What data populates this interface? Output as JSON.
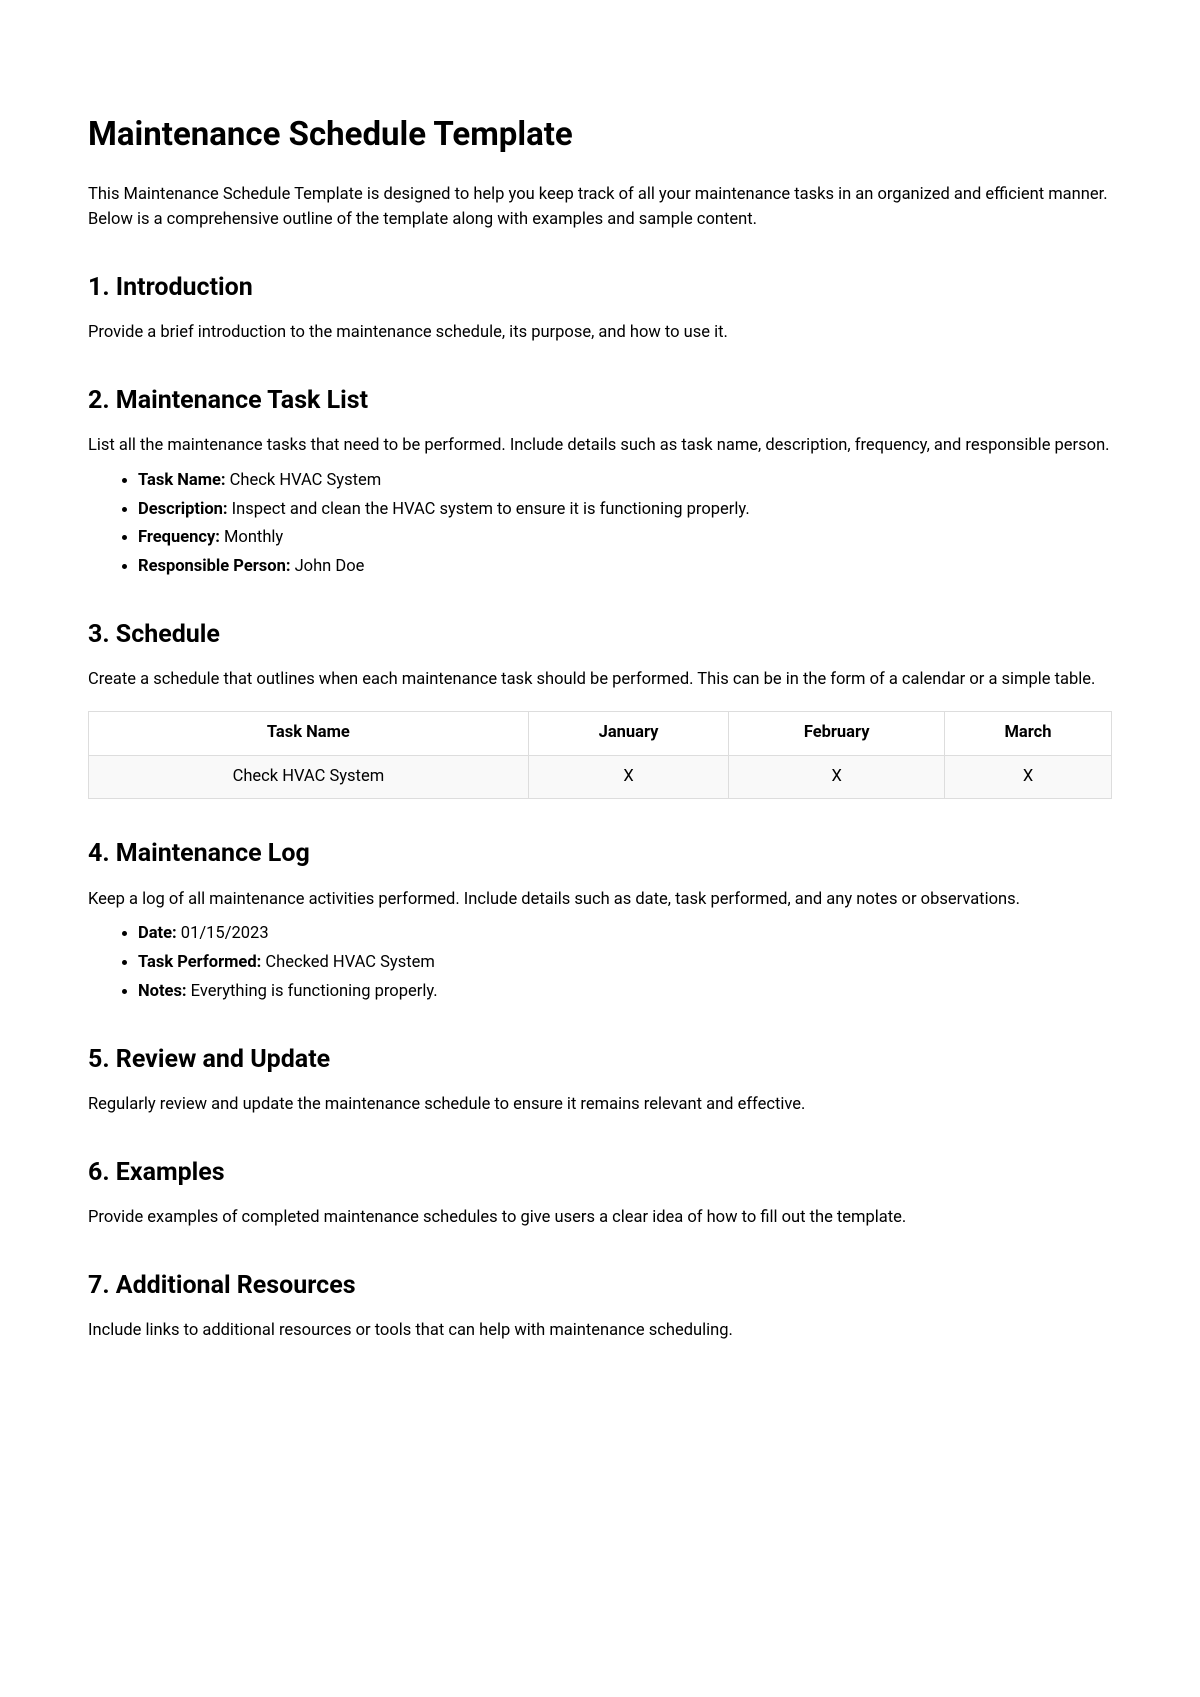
{
  "title": "Maintenance Schedule Template",
  "intro": "This Maintenance Schedule Template is designed to help you keep track of all your maintenance tasks in an organized and efficient manner. Below is a comprehensive outline of the template along with examples and sample content.",
  "sections": {
    "s1": {
      "heading": "1. Introduction",
      "body": "Provide a brief introduction to the maintenance schedule, its purpose, and how to use it."
    },
    "s2": {
      "heading": "2. Maintenance Task List",
      "body": "List all the maintenance tasks that need to be performed. Include details such as task name, description, frequency, and responsible person.",
      "items": [
        {
          "label": "Task Name:",
          "value": " Check HVAC System"
        },
        {
          "label": "Description:",
          "value": " Inspect and clean the HVAC system to ensure it is functioning properly."
        },
        {
          "label": "Frequency:",
          "value": " Monthly"
        },
        {
          "label": "Responsible Person:",
          "value": " John Doe"
        }
      ]
    },
    "s3": {
      "heading": "3. Schedule",
      "body": "Create a schedule that outlines when each maintenance task should be performed. This can be in the form of a calendar or a simple table.",
      "table": {
        "headers": [
          "Task Name",
          "January",
          "February",
          "March"
        ],
        "rows": [
          [
            "Check HVAC System",
            "X",
            "X",
            "X"
          ]
        ]
      }
    },
    "s4": {
      "heading": "4. Maintenance Log",
      "body": "Keep a log of all maintenance activities performed. Include details such as date, task performed, and any notes or observations.",
      "items": [
        {
          "label": "Date:",
          "value": " 01/15/2023"
        },
        {
          "label": "Task Performed:",
          "value": " Checked HVAC System"
        },
        {
          "label": "Notes:",
          "value": " Everything is functioning properly."
        }
      ]
    },
    "s5": {
      "heading": "5. Review and Update",
      "body": "Regularly review and update the maintenance schedule to ensure it remains relevant and effective."
    },
    "s6": {
      "heading": "6. Examples",
      "body": "Provide examples of completed maintenance schedules to give users a clear idea of how to fill out the template."
    },
    "s7": {
      "heading": "7. Additional Resources",
      "body": "Include links to additional resources or tools that can help with maintenance scheduling."
    }
  }
}
